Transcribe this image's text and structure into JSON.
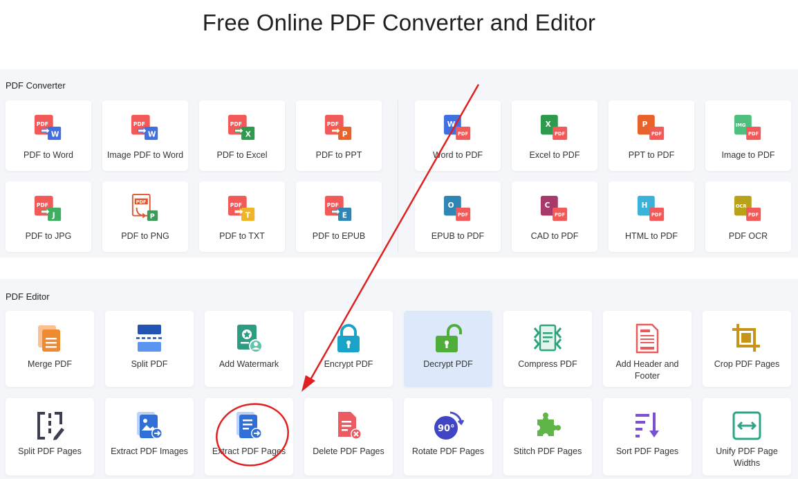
{
  "page": {
    "title": "Free Online PDF Converter and Editor"
  },
  "converter": {
    "label": "PDF Converter",
    "items": [
      {
        "label": "PDF to Word",
        "icon": "pdf-to-word-icon"
      },
      {
        "label": "Image PDF to Word",
        "icon": "image-pdf-to-word-icon"
      },
      {
        "label": "PDF to Excel",
        "icon": "pdf-to-excel-icon"
      },
      {
        "label": "PDF to PPT",
        "icon": "pdf-to-ppt-icon"
      },
      {
        "label": "Word to PDF",
        "icon": "word-to-pdf-icon"
      },
      {
        "label": "Excel to PDF",
        "icon": "excel-to-pdf-icon"
      },
      {
        "label": "PPT to PDF",
        "icon": "ppt-to-pdf-icon"
      },
      {
        "label": "Image to PDF",
        "icon": "image-to-pdf-icon"
      },
      {
        "label": "PDF to JPG",
        "icon": "pdf-to-jpg-icon"
      },
      {
        "label": "PDF to PNG",
        "icon": "pdf-to-png-icon"
      },
      {
        "label": "PDF to TXT",
        "icon": "pdf-to-txt-icon"
      },
      {
        "label": "PDF to EPUB",
        "icon": "pdf-to-epub-icon"
      },
      {
        "label": "EPUB to PDF",
        "icon": "epub-to-pdf-icon"
      },
      {
        "label": "CAD to PDF",
        "icon": "cad-to-pdf-icon"
      },
      {
        "label": "HTML to PDF",
        "icon": "html-to-pdf-icon"
      },
      {
        "label": "PDF OCR",
        "icon": "pdf-ocr-icon"
      }
    ]
  },
  "editor": {
    "label": "PDF Editor",
    "items": [
      {
        "label": "Merge PDF",
        "icon": "merge-pdf-icon"
      },
      {
        "label": "Split PDF",
        "icon": "split-pdf-icon"
      },
      {
        "label": "Add Watermark",
        "icon": "add-watermark-icon"
      },
      {
        "label": "Encrypt PDF",
        "icon": "encrypt-pdf-icon"
      },
      {
        "label": "Decrypt PDF",
        "icon": "decrypt-pdf-icon"
      },
      {
        "label": "Compress PDF",
        "icon": "compress-pdf-icon"
      },
      {
        "label": "Add Header and Footer",
        "icon": "add-header-footer-icon"
      },
      {
        "label": "Crop PDF Pages",
        "icon": "crop-pdf-pages-icon"
      },
      {
        "label": "Split PDF Pages",
        "icon": "split-pdf-pages-icon"
      },
      {
        "label": "Extract PDF Images",
        "icon": "extract-pdf-images-icon"
      },
      {
        "label": "Extract PDF Pages",
        "icon": "extract-pdf-pages-icon"
      },
      {
        "label": "Delete PDF Pages",
        "icon": "delete-pdf-pages-icon"
      },
      {
        "label": "Rotate PDF Pages",
        "icon": "rotate-pdf-pages-icon"
      },
      {
        "label": "Stitch PDF Pages",
        "icon": "stitch-pdf-pages-icon"
      },
      {
        "label": "Sort PDF Pages",
        "icon": "sort-pdf-pages-icon"
      },
      {
        "label": "Unify PDF Page Widths",
        "icon": "unify-page-widths-icon"
      }
    ]
  },
  "icon_text": {
    "pdf": "PDF",
    "w": "W",
    "x": "X",
    "p": "P",
    "j": "J",
    "t": "T",
    "e": "E",
    "o": "O",
    "c": "C",
    "h": "H",
    "img": "IMG",
    "ocr": "OCR",
    "rotate": "90°"
  },
  "annotation": {
    "arrow_color": "#e02020",
    "circle_target": "Extract PDF Pages"
  },
  "colors": {
    "pdf_red": "#f25a5a",
    "word_blue": "#3f6fe0",
    "excel_green": "#2e9a4d",
    "ppt_orange": "#e8632c",
    "highlight_bg": "#dde8fb"
  }
}
